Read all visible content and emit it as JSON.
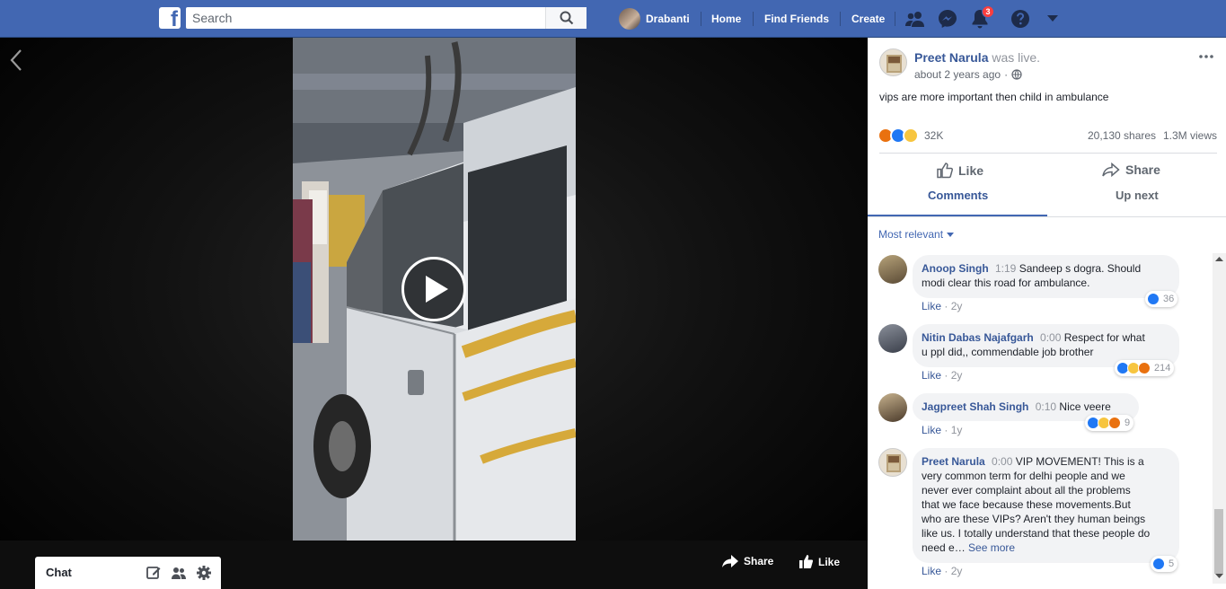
{
  "topbar": {
    "logo_letter": "f",
    "search_placeholder": "Search",
    "profile_name": "Drabanti",
    "nav": [
      "Home",
      "Find Friends",
      "Create"
    ],
    "notification_count": "3",
    "brand_color": "#4267b2"
  },
  "video": {
    "controls": {
      "share_label": "Share",
      "like_label": "Like"
    }
  },
  "chat": {
    "title": "Chat"
  },
  "post": {
    "author": "Preet Narula",
    "status": "was live.",
    "time": "about 2 years ago",
    "audience_icon": "globe-icon",
    "caption": "vips are more important then child in ambulance",
    "reactions_count": "32K",
    "shares": "20,130 shares",
    "views": "1.3M views",
    "like_label": "Like",
    "share_label": "Share",
    "tabs": [
      "Comments",
      "Up next"
    ],
    "sort_label": "Most relevant"
  },
  "comments": [
    {
      "author": "Anoop Singh",
      "time": "1:19",
      "text1": "Sandeep s dogra. Should",
      "text2": "modi clear this road for ambulance.",
      "like": "Like",
      "age": "2y",
      "count": "36"
    },
    {
      "author": "Nitin Dabas Najafgarh",
      "time": "0:00",
      "text1": "Respect for what",
      "text2": "u ppl did,, commendable job brother",
      "like": "Like",
      "age": "2y",
      "count": "214"
    },
    {
      "author": "Jagpreet Shah Singh",
      "time": "0:10",
      "text1": "Nice veere",
      "like": "Like",
      "age": "1y",
      "count": "9"
    },
    {
      "author": "Preet Narula",
      "time": "0:00",
      "lines": [
        "VIP MOVEMENT! This is a",
        "very common term for delhi people and we",
        "never ever complaint about all the problems",
        "that we face because these movements.But",
        "who are these VIPs? Aren't they human beings",
        "like us. I totally understand that these people do",
        "need e…"
      ],
      "see_more": "See more",
      "like": "Like",
      "age": "2y",
      "count": "5"
    }
  ]
}
